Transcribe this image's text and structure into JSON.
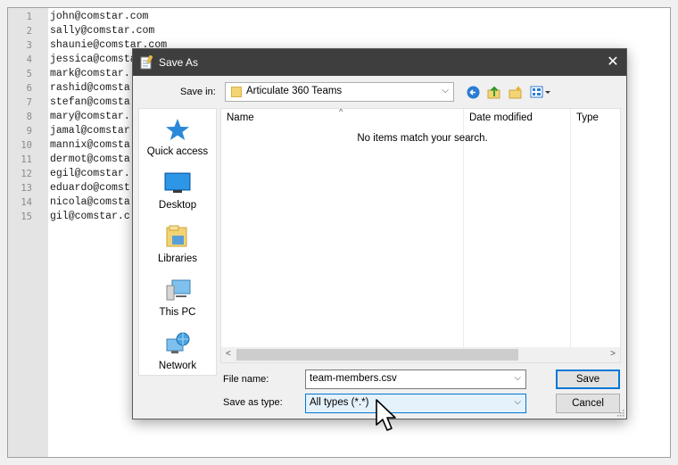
{
  "editor": {
    "lines": [
      {
        "n": "1",
        "text": "john@comstar.com"
      },
      {
        "n": "2",
        "text": "sally@comstar.com"
      },
      {
        "n": "3",
        "text": "shaunie@comstar.com"
      },
      {
        "n": "4",
        "text": "jessica@comstar"
      },
      {
        "n": "5",
        "text": "mark@comstar."
      },
      {
        "n": "6",
        "text": "rashid@comsta"
      },
      {
        "n": "7",
        "text": "stefan@comsta"
      },
      {
        "n": "8",
        "text": "mary@comstar."
      },
      {
        "n": "9",
        "text": "jamal@comstar"
      },
      {
        "n": "10",
        "text": "mannix@comsta"
      },
      {
        "n": "11",
        "text": "dermot@comsta"
      },
      {
        "n": "12",
        "text": "egil@comstar."
      },
      {
        "n": "13",
        "text": "eduardo@comst"
      },
      {
        "n": "14",
        "text": "nicola@comsta"
      },
      {
        "n": "15",
        "text": "gil@comstar.c"
      }
    ]
  },
  "dialog": {
    "title": "Save As",
    "close_glyph": "✕",
    "save_in_label": "Save in:",
    "save_in_value": "Articulate 360 Teams",
    "toolbar_icons": [
      "back-icon",
      "up-folder-icon",
      "new-folder-icon",
      "view-menu-icon"
    ],
    "places": [
      {
        "label": "Quick access",
        "icon": "quick-access-star-icon"
      },
      {
        "label": "Desktop",
        "icon": "desktop-icon"
      },
      {
        "label": "Libraries",
        "icon": "libraries-icon"
      },
      {
        "label": "This PC",
        "icon": "this-pc-icon"
      },
      {
        "label": "Network",
        "icon": "network-icon"
      }
    ],
    "columns": [
      "Name",
      "Date modified",
      "Type"
    ],
    "sort_glyph": "^",
    "empty_message": "No items match your search.",
    "file_name_label": "File name:",
    "file_name_value": "team-members.csv",
    "save_type_label": "Save as type:",
    "save_type_value": "All types (*.*)",
    "save_button": "Save",
    "cancel_button": "Cancel",
    "dropdown_glyph": "⌵",
    "scroll_left": "<",
    "scroll_right": ">"
  },
  "colors": {
    "title_bar": "#3e3e3e",
    "accent": "#0078d7",
    "quick_access_blue": "#2b88d8"
  }
}
